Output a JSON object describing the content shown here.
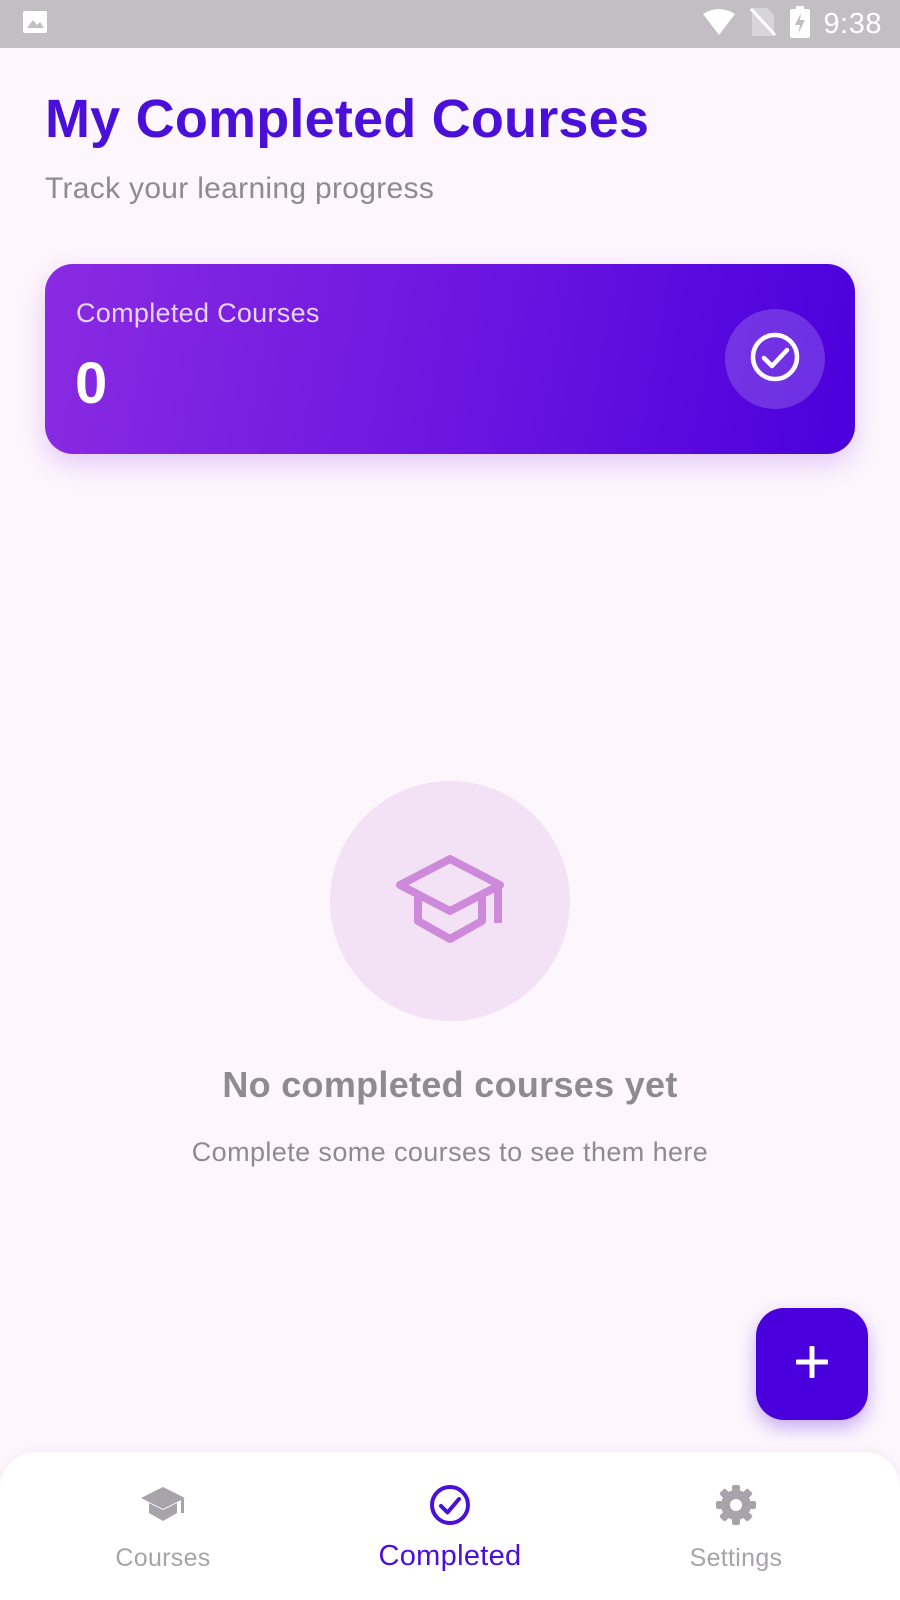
{
  "status_bar": {
    "time": "9:38",
    "icons": [
      "image-icon",
      "wifi-icon",
      "no-sim-icon",
      "battery-charging-icon"
    ]
  },
  "header": {
    "title": "My Completed Courses",
    "subtitle": "Track your learning progress"
  },
  "stat_card": {
    "label": "Completed Courses",
    "value": "0",
    "icon": "check-circle-icon"
  },
  "empty_state": {
    "icon": "graduation-cap-icon",
    "title": "No completed courses yet",
    "subtitle": "Complete some courses to see them here"
  },
  "fab": {
    "icon": "plus-icon"
  },
  "bottom_nav": {
    "items": [
      {
        "label": "Courses",
        "icon": "graduation-cap-icon",
        "active": false
      },
      {
        "label": "Completed",
        "icon": "check-circle-icon",
        "active": true
      },
      {
        "label": "Settings",
        "icon": "gear-icon",
        "active": false
      }
    ]
  },
  "colors": {
    "primary": "#4A0FD9",
    "accent_gradient_start": "#8A2BE2",
    "accent_gradient_end": "#4A00DC",
    "background": "#FDF6FD",
    "muted_text": "#8E8A92",
    "empty_circle": "#F3E2F6",
    "empty_icon": "#CE8ADA"
  }
}
